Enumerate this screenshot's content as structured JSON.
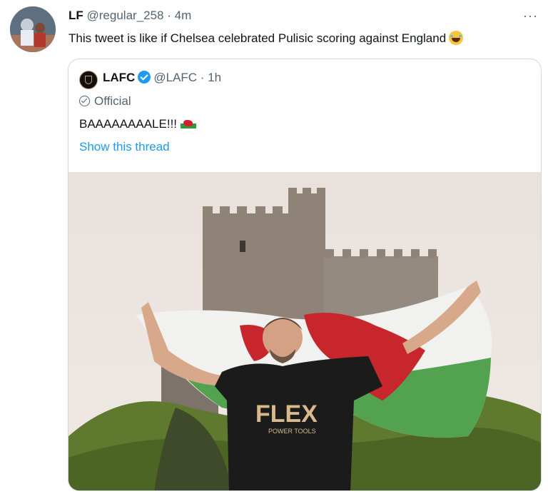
{
  "tweet": {
    "author_name": "LF",
    "author_handle": "@regular_258",
    "time": " · 4m",
    "more": "···",
    "text": "This tweet is like if Chelsea celebrated Pulisic scoring against England",
    "emoji": "face-with-tears-of-joy-icon"
  },
  "quoted": {
    "author_name": "LAFC",
    "author_handle": "@LAFC",
    "time": " · 1h",
    "label": "Official",
    "text": "BAAAAAAAALE!!!",
    "emoji": "wales-flag-icon",
    "thread_link": "Show this thread",
    "photo_shirt_text": "FLEX",
    "photo_shirt_subtext": "POWER TOOLS",
    "colors": {
      "link": "#1d9bf0",
      "verified": "#1d9bf0",
      "muted": "#536471"
    }
  }
}
